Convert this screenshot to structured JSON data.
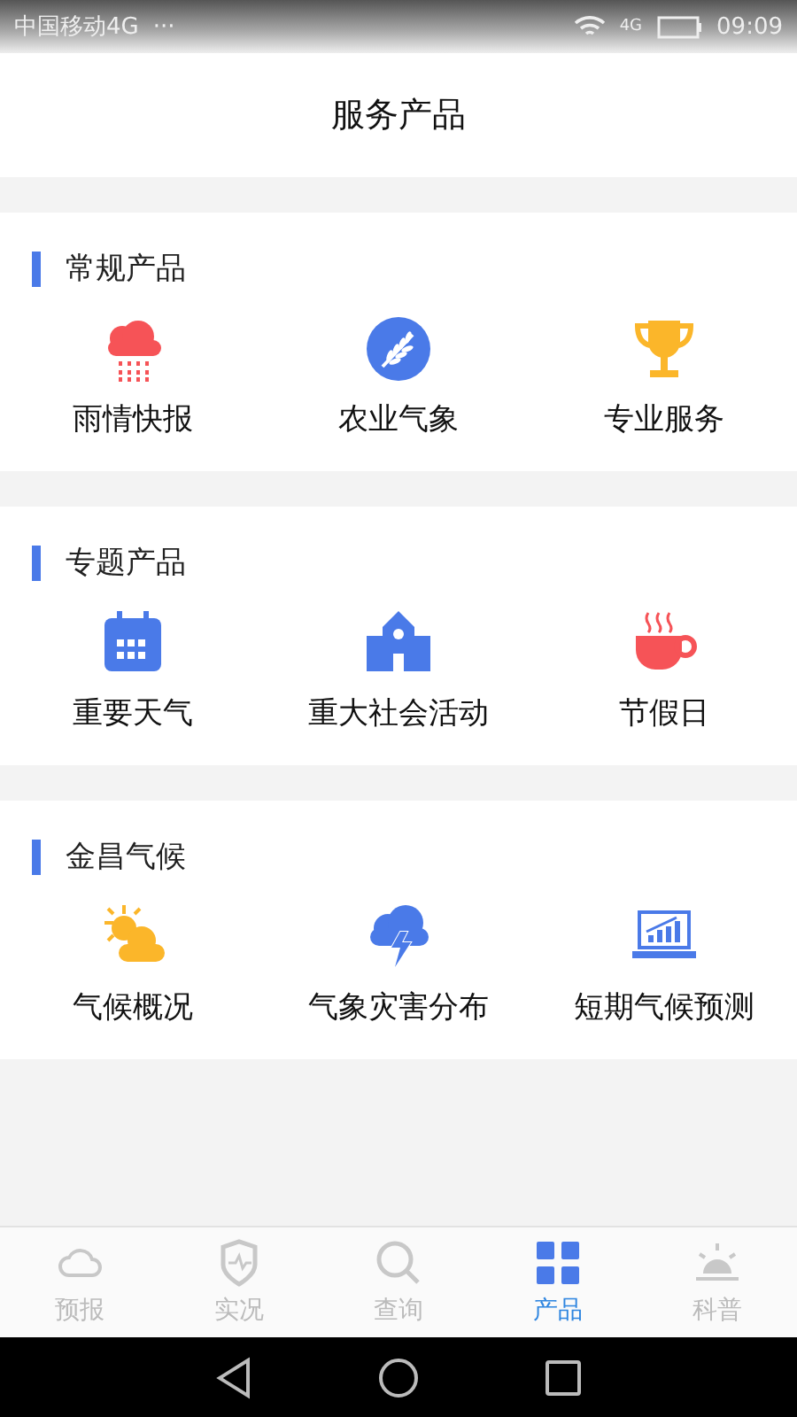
{
  "status_bar": {
    "carrier": "中国移动4G",
    "more": "···",
    "network": "4G",
    "time": "09:09"
  },
  "header": {
    "title": "服务产品"
  },
  "sections": [
    {
      "title": "常规产品",
      "items": [
        {
          "label": "雨情快报"
        },
        {
          "label": "农业气象"
        },
        {
          "label": "专业服务"
        }
      ]
    },
    {
      "title": "专题产品",
      "items": [
        {
          "label": "重要天气"
        },
        {
          "label": "重大社会活动"
        },
        {
          "label": "节假日"
        }
      ]
    },
    {
      "title": "金昌气候",
      "items": [
        {
          "label": "气候概况"
        },
        {
          "label": "气象灾害分布"
        },
        {
          "label": "短期气候预测"
        }
      ]
    }
  ],
  "tabs": [
    {
      "label": "预报",
      "selected": false
    },
    {
      "label": "实况",
      "selected": false
    },
    {
      "label": "查询",
      "selected": false
    },
    {
      "label": "产品",
      "selected": true
    },
    {
      "label": "科普",
      "selected": false
    }
  ]
}
